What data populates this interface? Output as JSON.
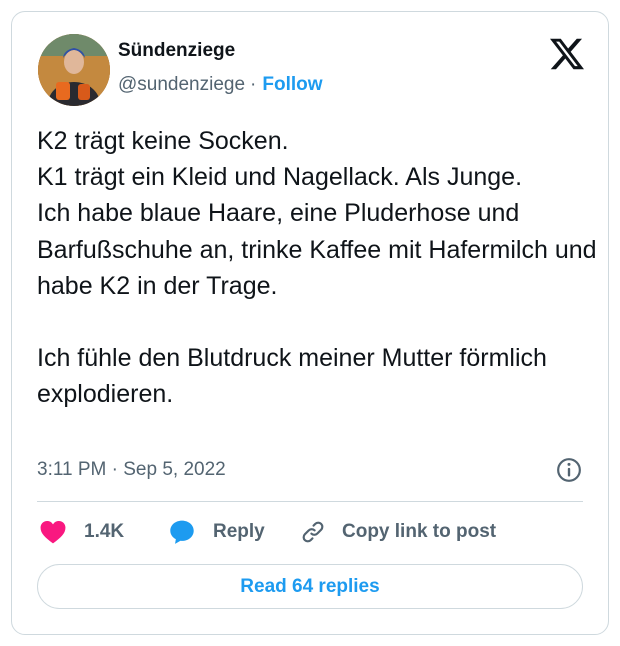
{
  "author": {
    "name": "Sündenziege",
    "handle": "@sundenziege",
    "separator": "·",
    "follow_label": "Follow"
  },
  "tweet": {
    "text": "K2 trägt keine Socken.\nK1 trägt ein Kleid und Nagellack. Als Junge.\nIch habe blaue Haare, eine Pluderhose und Barfußschuhe an, trinke Kaffee mit Hafermilch und habe K2 in der Trage.\n\nIch fühle den Blutdruck meiner Mutter förmlich explodieren.",
    "timestamp": "3:11 PM · Sep 5, 2022"
  },
  "actions": {
    "likes": "1.4K",
    "reply_label": "Reply",
    "copy_link_label": "Copy link to post"
  },
  "read_replies_label": "Read 64 replies",
  "icons": {
    "logo": "x-logo-icon",
    "info": "info-icon",
    "like": "heart-icon",
    "reply": "speech-bubble-icon",
    "copy": "link-icon"
  },
  "colors": {
    "accent": "#1d9bf0",
    "like": "#f91880",
    "secondary_text": "#536471",
    "border": "#cfd9de"
  }
}
